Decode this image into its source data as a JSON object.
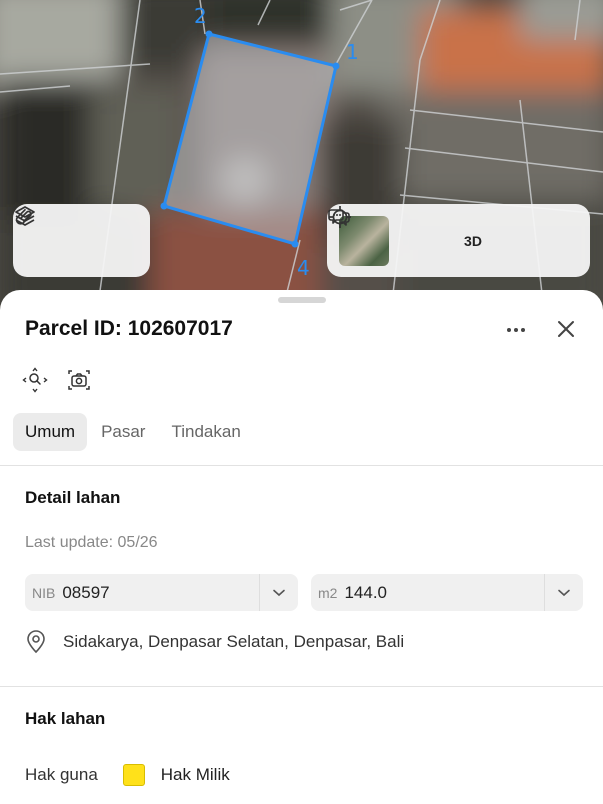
{
  "map": {
    "vertex_labels": [
      "1",
      "2",
      "4"
    ],
    "layer_panel": {
      "icons": [
        "layers-icon",
        "paperclip-icon"
      ]
    },
    "control_panel": {
      "icons": [
        "satellite-thumbnail",
        "locate-icon",
        "3d-icon",
        "chat-icon"
      ],
      "three_d_label": "3D"
    },
    "parcel_color": "#2a8cf0"
  },
  "sheet": {
    "title": "Parcel ID: 102607017",
    "tabs": [
      {
        "label": "Umum",
        "active": true
      },
      {
        "label": "Pasar",
        "active": false
      },
      {
        "label": "Tindakan",
        "active": false
      }
    ],
    "detail": {
      "heading": "Detail lahan",
      "last_update": "Last update: 05/26",
      "nib_prefix": "NIB",
      "nib_value": "08597",
      "area_prefix": "m2",
      "area_value": "144.0",
      "location": "Sidakarya, Denpasar Selatan, Denpasar, Bali"
    },
    "rights": {
      "heading": "Hak lahan",
      "label": "Hak guna",
      "value": "Hak Milik",
      "swatch_color": "#ffe11a"
    }
  }
}
